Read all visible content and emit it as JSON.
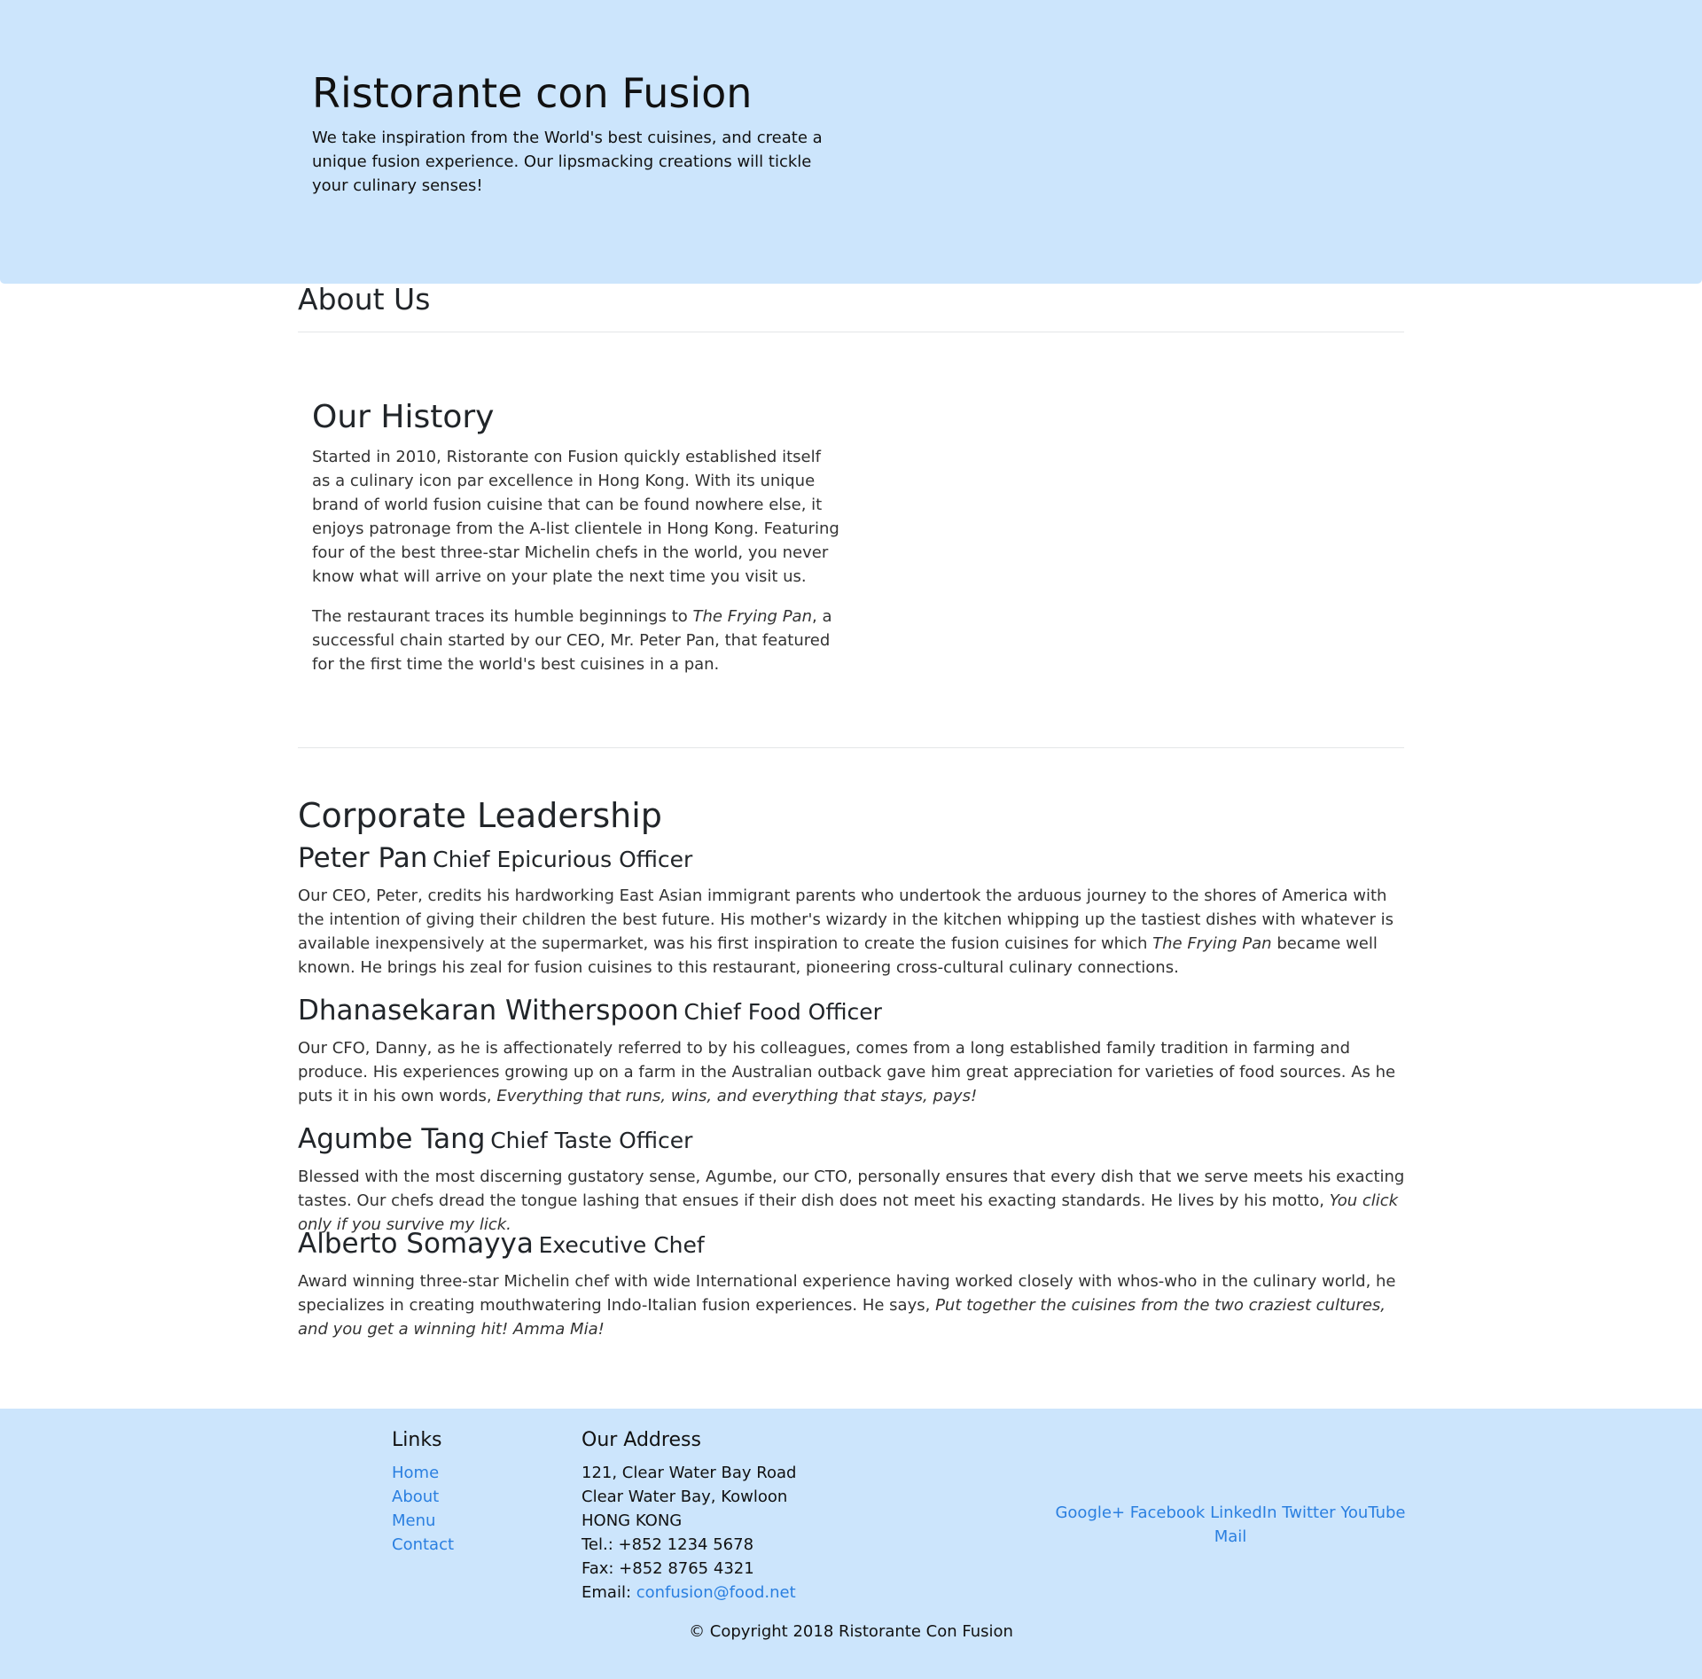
{
  "header": {
    "title": "Ristorante con Fusion",
    "description": "We take inspiration from the World's best cuisines, and create a unique fusion experience. Our lipsmacking creations will tickle your culinary senses!"
  },
  "about": {
    "title": "About Us",
    "history_title": "Our History",
    "history_p1": "Started in 2010, Ristorante con Fusion quickly established itself as a culinary icon par excellence in Hong Kong. With its unique brand of world fusion cuisine that can be found nowhere else, it enjoys patronage from the A-list clientele in Hong Kong. Featuring four of the best three-star Michelin chefs in the world, you never know what will arrive on your plate the next time you visit us.",
    "history_p2_pre": "The restaurant traces its humble beginnings to ",
    "history_p2_em": "The Frying Pan",
    "history_p2_post": ", a successful chain started by our CEO, Mr. Peter Pan, that featured for the first time the world's best cuisines in a pan."
  },
  "leadership": {
    "title": "Corporate Leadership",
    "leaders": [
      {
        "name": "Peter Pan",
        "role": "Chief Epicurious Officer",
        "bio_pre": "Our CEO, Peter, credits his hardworking East Asian immigrant parents who undertook the arduous journey to the shores of America with the intention of giving their children the best future. His mother's wizardy in the kitchen whipping up the tastiest dishes with whatever is available inexpensively at the supermarket, was his first inspiration to create the fusion cuisines for which ",
        "bio_em": "The Frying Pan",
        "bio_post": " became well known. He brings his zeal for fusion cuisines to this restaurant, pioneering cross-cultural culinary connections."
      },
      {
        "name": "Dhanasekaran Witherspoon",
        "role": "Chief Food Officer",
        "bio_pre": "Our CFO, Danny, as he is affectionately referred to by his colleagues, comes from a long established family tradition in farming and produce. His experiences growing up on a farm in the Australian outback gave him great appreciation for varieties of food sources. As he puts it in his own words, ",
        "bio_em": "Everything that runs, wins, and everything that stays, pays!",
        "bio_post": ""
      },
      {
        "name": "Agumbe Tang",
        "role": "Chief Taste Officer",
        "bio_pre": "Blessed with the most discerning gustatory sense, Agumbe, our CTO, personally ensures that every dish that we serve meets his exacting tastes. Our chefs dread the tongue lashing that ensues if their dish does not meet his exacting standards. He lives by his motto, ",
        "bio_em": "You click only if you survive my lick.",
        "bio_post": ""
      },
      {
        "name": "Alberto Somayya",
        "role": "Executive Chef",
        "bio_pre": "Award winning three-star Michelin chef with wide International experience having worked closely with whos-who in the culinary world, he specializes in creating mouthwatering Indo-Italian fusion experiences. He says, ",
        "bio_em": "Put together the cuisines from the two craziest cultures, and you get a winning hit! Amma Mia!",
        "bio_post": ""
      }
    ]
  },
  "footer": {
    "links_title": "Links",
    "links": [
      "Home",
      "About",
      "Menu",
      "Contact"
    ],
    "address_title": "Our Address",
    "address_line1": "121, Clear Water Bay Road",
    "address_line2": "Clear Water Bay, Kowloon",
    "address_line3": "HONG KONG",
    "tel": "Tel.: +852 1234 5678",
    "fax": "Fax: +852 8765 4321",
    "email_label": "Email: ",
    "email": "confusion@food.net",
    "social": [
      "Google+",
      "Facebook",
      "LinkedIn",
      "Twitter",
      "YouTube",
      "Mail"
    ],
    "copyright": "© Copyright 2018 Ristorante Con Fusion"
  },
  "colors": {
    "jumbotron_bg": "#cce5fc",
    "footer_bg": "#cce5fc",
    "link": "#2a7fe0"
  }
}
